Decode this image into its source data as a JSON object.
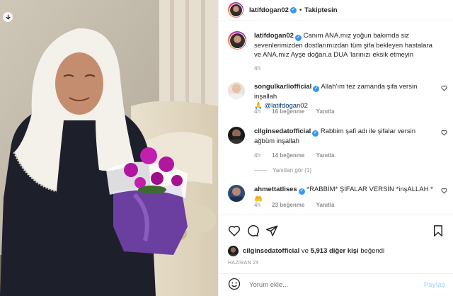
{
  "header": {
    "username": "latifdogan02",
    "separator": "•",
    "follow_label": "Takiptesin"
  },
  "caption": {
    "username": "latifdogan02",
    "text": "Canım ANA.mız yoğun bakımda siz sevenlerimizden dostlarımızdan tüm şifa bekleyen hastalara ve ANA.mız Ayşe doğan.a DUA 'larınızı eksik etmeyin",
    "time": "4h"
  },
  "comments": [
    {
      "username": "songulkarliofficial",
      "text": "Allah'ım tez zamanda şifa versin inşallah",
      "line2_icon": "🙏",
      "mention": "@latifdogan02",
      "time": "4h",
      "likes": "16 beğenme",
      "reply": "Yanıtla"
    },
    {
      "username": "cilginsedatofficial",
      "text": "Rabbim şafi adı ile şifalar versin ağbüm inşallah",
      "time": "4h",
      "likes": "14 beğenme",
      "reply": "Yanıtla",
      "view_replies": "Yanıtları gör (1)"
    },
    {
      "username": "ahmettatlises",
      "text": "*RABBİM* ŞİFALAR VERSİN *inşALLAH * 🤲",
      "time": "4h",
      "likes": "23 beğenme",
      "reply": "Yanıtla"
    }
  ],
  "likes": {
    "user": "cilginsedatofficial",
    "connector": "ve",
    "others": "5,913 diğer kişi",
    "suffix": "beğendi"
  },
  "date": "HAZİRAN 24",
  "add_comment": {
    "placeholder": "Yorum ekle...",
    "share_label": "Paylaş"
  },
  "colors": {
    "verified": "#3897f0",
    "text": "#262626",
    "muted": "#8e8e8e",
    "share_disabled": "#b2dffc",
    "flowers": "#b0179e"
  },
  "icons": {
    "download": "download-icon",
    "heart": "heart-icon",
    "comment": "comment-icon",
    "share": "send-icon",
    "save": "bookmark-icon",
    "emoji": "emoji-icon"
  }
}
